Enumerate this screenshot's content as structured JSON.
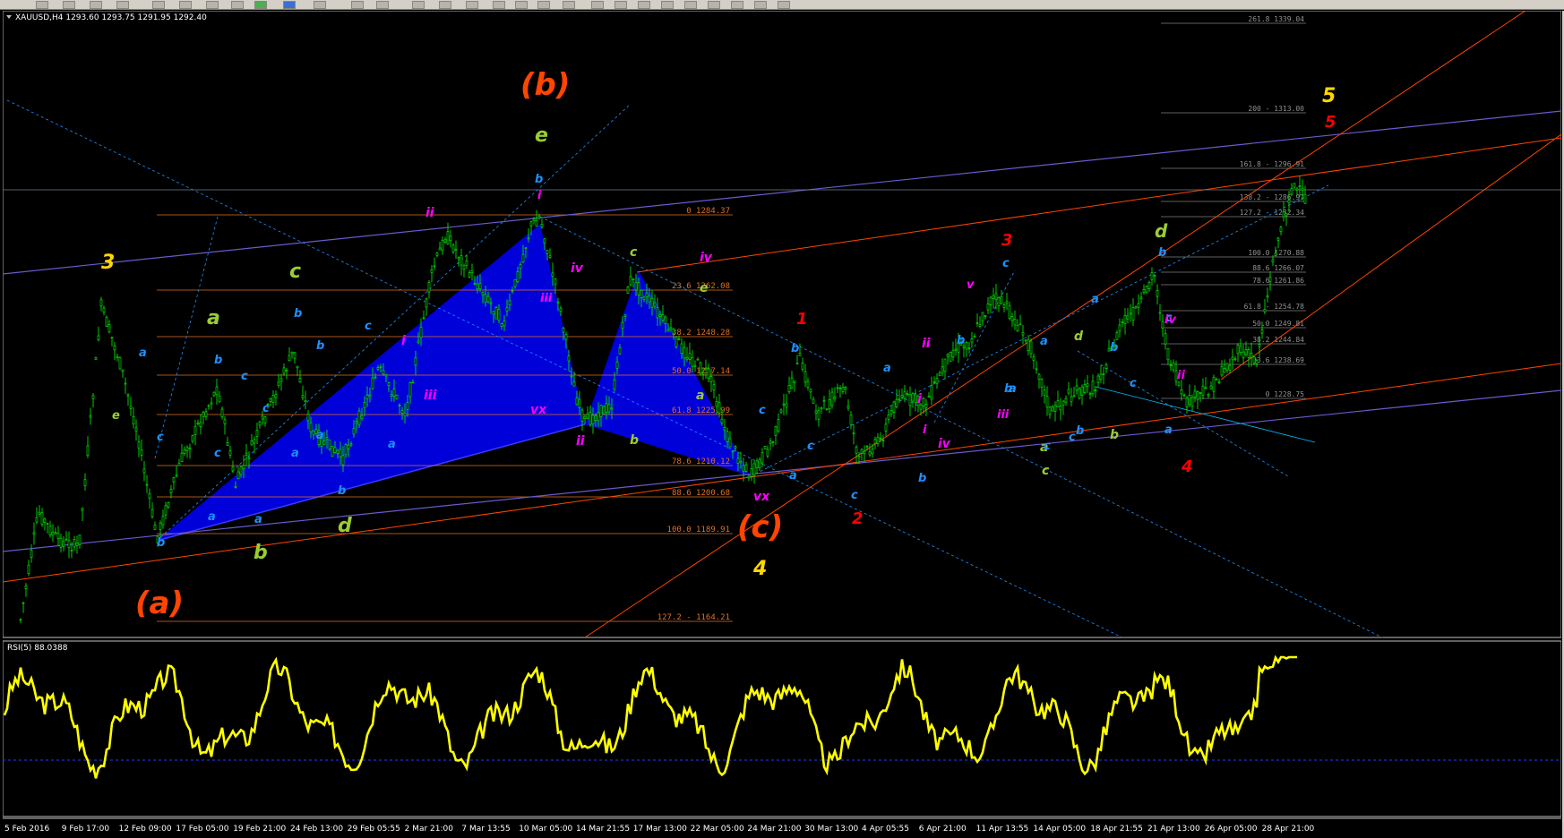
{
  "symbol_header": "XAUUSD,H4  1293.60 1293.75 1291.95 1292.40",
  "rsi_header": "RSI(5) 88.0388",
  "time_labels": [
    "5 Feb 2016",
    "9 Feb 17:00",
    "12 Feb 09:00",
    "17 Feb 05:00",
    "19 Feb 21:00",
    "24 Feb 13:00",
    "29 Feb 05:55",
    "2 Mar 21:00",
    "7 Mar 13:55",
    "10 Mar 05:00",
    "14 Mar 21:55",
    "17 Mar 13:00",
    "22 Mar 05:00",
    "24 Mar 21:00",
    "30 Mar 13:00",
    "4 Apr 05:55",
    "6 Apr 21:00",
    "11 Apr 13:55",
    "14 Apr 05:00",
    "18 Apr 21:55",
    "21 Apr 13:00",
    "26 Apr 05:00",
    "28 Apr 21:00"
  ],
  "fib_left": [
    "0 1284.37",
    "23.6 1262.08",
    "38.2 1248.28",
    "50.0 1237.14",
    "61.8 1225.99",
    "78.6 1210.12",
    "88.6 1200.68",
    "100.0 1189.91",
    "127.2 - 1164.21"
  ],
  "fib_right": [
    "261.8 1339.04",
    "200 - 1313.00",
    "161.8 - 1296.91",
    "138.2 - 1286.97",
    "127.2 - 1282.34",
    "100.0 1270.88",
    "88.6 1266.07",
    "78.6 1261.86",
    "61.8 - 1254.78",
    "50.0 1249.81",
    "38.2 1244.84",
    "23.6 1238.69",
    "0 1228.75"
  ],
  "wave_labels": [
    {
      "t": "(a)",
      "c": "#ff4500"
    },
    {
      "t": "(b)",
      "c": "#ff4500"
    },
    {
      "t": "(c)",
      "c": "#ff4500"
    },
    {
      "t": "3",
      "c": "#ffd700"
    },
    {
      "t": "4",
      "c": "#ffd700"
    },
    {
      "t": "5",
      "c": "#ffd700"
    },
    {
      "t": "1",
      "c": "#ff0000"
    },
    {
      "t": "2",
      "c": "#ff0000"
    },
    {
      "t": "3",
      "c": "#ff0000"
    },
    {
      "t": "4",
      "c": "#ff0000"
    },
    {
      "t": "5",
      "c": "#ff0000"
    },
    {
      "t": "a",
      "c": "#9acd32"
    },
    {
      "t": "b",
      "c": "#9acd32"
    },
    {
      "t": "c",
      "c": "#9acd32"
    },
    {
      "t": "d",
      "c": "#9acd32"
    },
    {
      "t": "e",
      "c": "#9acd32"
    },
    {
      "t": "c",
      "c": "#9acd32"
    },
    {
      "t": "e",
      "c": "#9acd32"
    },
    {
      "t": "a",
      "c": "#9acd32"
    },
    {
      "t": "b",
      "c": "#9acd32"
    },
    {
      "t": "d",
      "c": "#9acd32"
    },
    {
      "t": "d",
      "c": "#9acd32"
    },
    {
      "t": "b",
      "c": "#9acd32"
    },
    {
      "t": "c",
      "c": "#9acd32"
    },
    {
      "t": "a",
      "c": "#9acd32"
    },
    {
      "t": "e",
      "c": "#9acd32"
    },
    {
      "t": "a",
      "c": "#1e90ff"
    },
    {
      "t": "b",
      "c": "#1e90ff"
    },
    {
      "t": "c",
      "c": "#1e90ff"
    },
    {
      "t": "a",
      "c": "#1e90ff"
    },
    {
      "t": "b",
      "c": "#1e90ff"
    },
    {
      "t": "c",
      "c": "#1e90ff"
    },
    {
      "t": "a",
      "c": "#1e90ff"
    },
    {
      "t": "b",
      "c": "#1e90ff"
    },
    {
      "t": "c",
      "c": "#1e90ff"
    },
    {
      "t": "a",
      "c": "#1e90ff"
    },
    {
      "t": "b",
      "c": "#1e90ff"
    },
    {
      "t": "c",
      "c": "#1e90ff"
    },
    {
      "t": "a",
      "c": "#1e90ff"
    },
    {
      "t": "b",
      "c": "#1e90ff"
    },
    {
      "t": "c",
      "c": "#1e90ff"
    },
    {
      "t": "a",
      "c": "#1e90ff"
    },
    {
      "t": "b",
      "c": "#1e90ff"
    },
    {
      "t": "c",
      "c": "#1e90ff"
    },
    {
      "t": "a",
      "c": "#1e90ff"
    },
    {
      "t": "b",
      "c": "#1e90ff"
    },
    {
      "t": "c",
      "c": "#1e90ff"
    },
    {
      "t": "c",
      "c": "#1e90ff"
    },
    {
      "t": "a",
      "c": "#1e90ff"
    },
    {
      "t": "b",
      "c": "#1e90ff"
    },
    {
      "t": "c",
      "c": "#1e90ff"
    },
    {
      "t": "a",
      "c": "#1e90ff"
    },
    {
      "t": "b",
      "c": "#1e90ff"
    },
    {
      "t": "c",
      "c": "#1e90ff"
    },
    {
      "t": "a",
      "c": "#1e90ff"
    },
    {
      "t": "b",
      "c": "#1e90ff"
    },
    {
      "t": "c",
      "c": "#1e90ff"
    },
    {
      "t": "a",
      "c": "#1e90ff"
    },
    {
      "t": "b",
      "c": "#1e90ff"
    },
    {
      "t": "c",
      "c": "#1e90ff"
    },
    {
      "t": "b",
      "c": "#1e90ff"
    },
    {
      "t": "c",
      "c": "#1e90ff"
    },
    {
      "t": "a",
      "c": "#1e90ff"
    },
    {
      "t": "b",
      "c": "#1e90ff"
    },
    {
      "t": "iii",
      "c": "#ff00ff"
    },
    {
      "t": "v",
      "c": "#ff00ff"
    },
    {
      "t": "i",
      "c": "#ff00ff"
    },
    {
      "t": "ii",
      "c": "#ff00ff"
    },
    {
      "t": "iv",
      "c": "#ff00ff"
    },
    {
      "t": "ii",
      "c": "#ff00ff"
    },
    {
      "t": "i",
      "c": "#ff00ff"
    },
    {
      "t": "iii",
      "c": "#ff00ff"
    },
    {
      "t": "iv",
      "c": "#ff00ff"
    },
    {
      "t": "vx",
      "c": "#ff00ff"
    },
    {
      "t": "iii",
      "c": "#ff00ff"
    },
    {
      "t": "i",
      "c": "#ff00ff"
    },
    {
      "t": "ii",
      "c": "#ff00ff"
    },
    {
      "t": "iv",
      "c": "#ff00ff"
    },
    {
      "t": "vx",
      "c": "#ff00ff"
    },
    {
      "t": "ii",
      "c": "#ff00ff"
    },
    {
      "t": "i",
      "c": "#ff00ff"
    },
    {
      "t": "iv",
      "c": "#ff00ff"
    }
  ]
}
